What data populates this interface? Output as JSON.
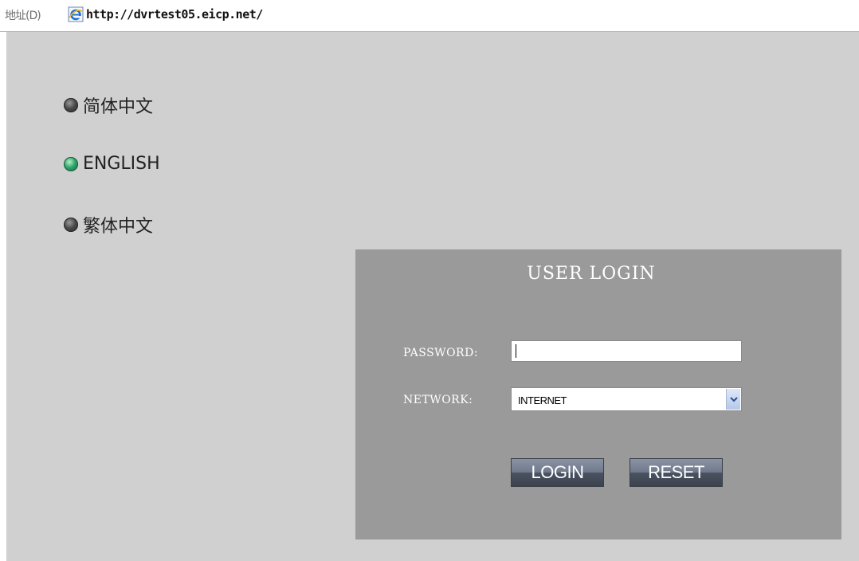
{
  "address_bar": {
    "label": "地址(D)",
    "url": "http://dvrtest05.eicp.net/"
  },
  "languages": [
    {
      "label": "简体中文",
      "active": false
    },
    {
      "label": "ENGLISH",
      "active": true
    },
    {
      "label": "繁体中文",
      "active": false
    }
  ],
  "login": {
    "title": "USER LOGIN",
    "password_label": "PASSWORD:",
    "password_value": "",
    "network_label": "NETWORK:",
    "network_value": "INTERNET",
    "login_button": "LOGIN",
    "reset_button": "RESET"
  },
  "colors": {
    "page_bg": "#d0d0d0",
    "panel_bg": "#9a9a9a",
    "active_lang": "#2ea36a",
    "inactive_lang": "#4a4a4a"
  }
}
